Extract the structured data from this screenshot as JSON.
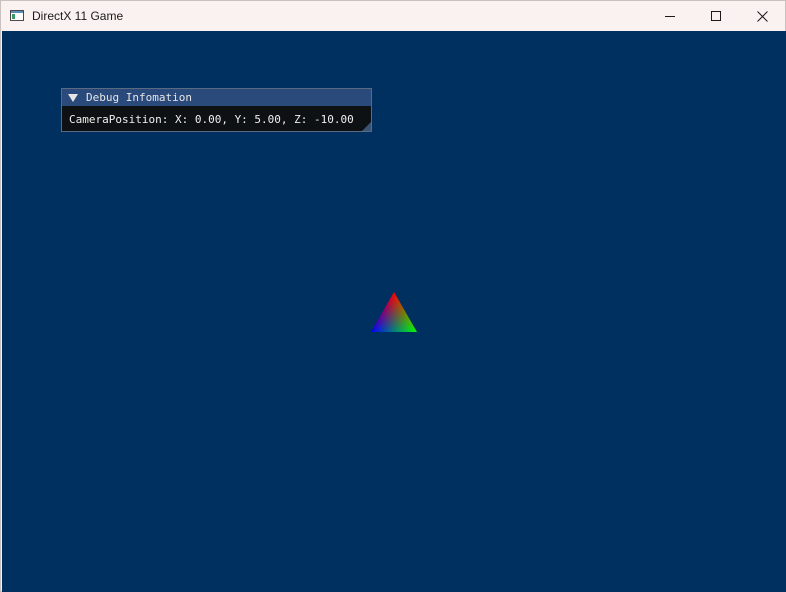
{
  "window": {
    "title": "DirectX 11 Game",
    "icons": {
      "app": "app-window-icon",
      "minimize": "minimize-icon",
      "maximize": "maximize-icon",
      "close": "close-icon"
    }
  },
  "viewport": {
    "clear_color": "#00305f"
  },
  "debug_panel": {
    "title": "Debug Infomation",
    "collapse_icon": "collapse-arrow-icon",
    "camera_position_text": "CameraPosition: X: 0.00, Y: 5.00, Z: -10.00"
  },
  "scene": {
    "object": "triangle",
    "vertex_colors": [
      "#ff0000",
      "#00ff00",
      "#0000ff"
    ]
  }
}
